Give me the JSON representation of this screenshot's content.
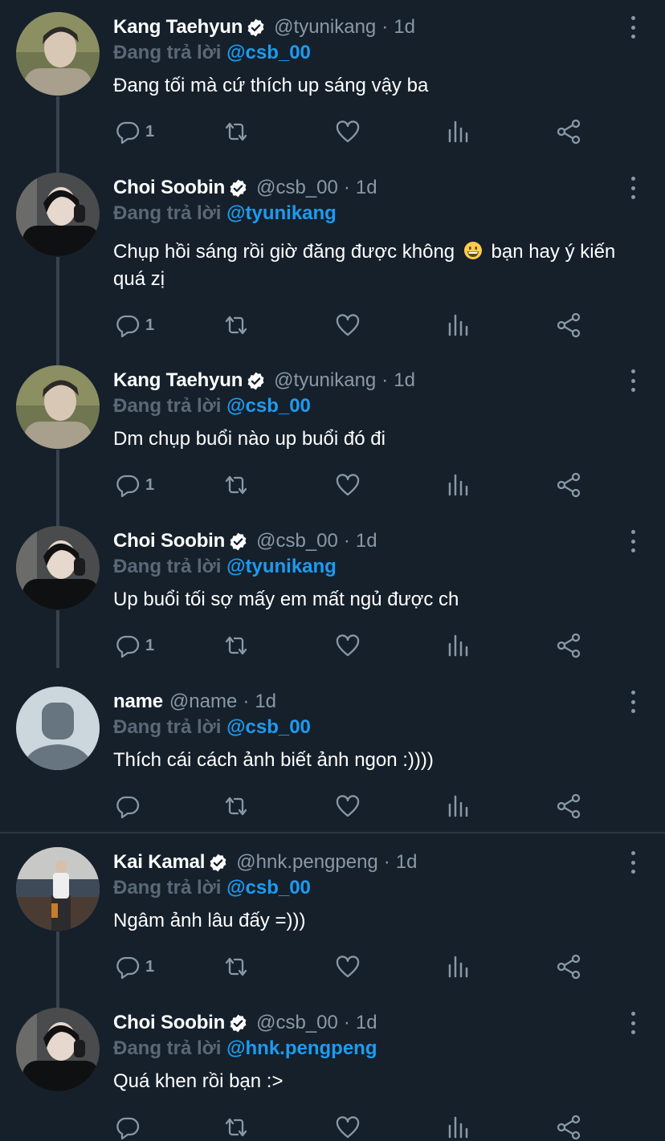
{
  "reply_prefix": "Đang trả lời",
  "tweets": [
    {
      "name": "Kang Taehyun",
      "verified": true,
      "handle": "@tyunikang",
      "sep": "·",
      "time": "1d",
      "reply_to": "@csb_00",
      "text": "Đang tối mà cứ thích up sáng vậy ba",
      "reply_count": "1",
      "avatar": "taehyun"
    },
    {
      "name": "Choi Soobin",
      "verified": true,
      "handle": "@csb_00",
      "sep": "·",
      "time": "1d",
      "reply_to": "@tyunikang",
      "text_a": "Chụp hồi sáng rồi giờ đăng được không",
      "text_b": "bạn hay ý kiến quá zị",
      "emoji": "grinning-face",
      "reply_count": "1",
      "avatar": "soobin"
    },
    {
      "name": "Kang Taehyun",
      "verified": true,
      "handle": "@tyunikang",
      "sep": "·",
      "time": "1d",
      "reply_to": "@csb_00",
      "text": "Dm chụp buổi nào up buổi đó đi",
      "reply_count": "1",
      "avatar": "taehyun"
    },
    {
      "name": "Choi Soobin",
      "verified": true,
      "handle": "@csb_00",
      "sep": "·",
      "time": "1d",
      "reply_to": "@tyunikang",
      "text": "Up buổi tối sợ mấy em mất ngủ được ch",
      "reply_count": "1",
      "avatar": "soobin"
    },
    {
      "name": "name",
      "verified": false,
      "handle": "@name",
      "sep": "·",
      "time": "1d",
      "reply_to": "@csb_00",
      "text": "Thích cái cách ảnh biết ảnh ngon :))))",
      "reply_count": "",
      "avatar": "default"
    },
    {
      "name": "Kai Kamal",
      "verified": true,
      "handle": "@hnk.pengpeng",
      "sep": "·",
      "time": "1d",
      "reply_to": "@csb_00",
      "text": "Ngâm ảnh lâu đấy =)))",
      "reply_count": "1",
      "avatar": "kai"
    },
    {
      "name": "Choi Soobin",
      "verified": true,
      "handle": "@csb_00",
      "sep": "·",
      "time": "1d",
      "reply_to": "@hnk.pengpeng",
      "text": "Quá khen rồi bạn :>",
      "reply_count": "",
      "avatar": "soobin"
    }
  ],
  "icons": {
    "reply": "comment-bubble-icon",
    "retweet": "retweet-icon",
    "like": "heart-icon",
    "views": "analytics-bars-icon",
    "share": "share-icon",
    "more": "more-vertical-icon",
    "verified": "verified-badge-icon"
  },
  "colors": {
    "background": "#15202b",
    "mention": "#1d9bf0",
    "muted": "#8899a6",
    "reply_label": "#5b6876",
    "thread_line": "#38444d",
    "verified_badge": "#ffffff"
  }
}
